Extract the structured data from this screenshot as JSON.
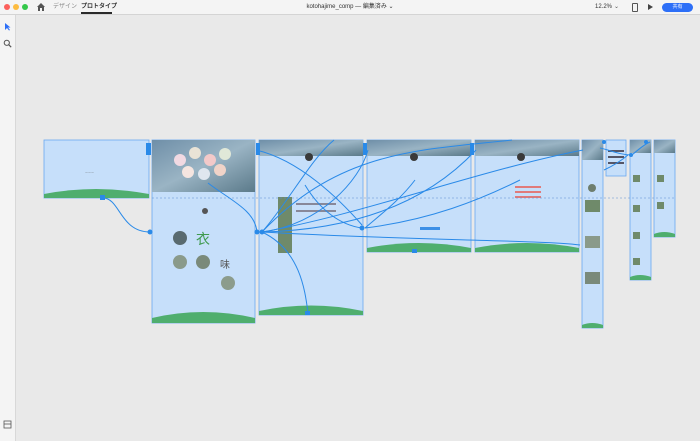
{
  "titlebar": {
    "tabs": {
      "design": "デザイン",
      "prototype": "プロトタイプ"
    },
    "document_title": "kotohajime_comp — 編集済み ⌄",
    "zoom": "12.2%",
    "share_label": "共有"
  },
  "toolbar": {
    "tools": [
      "select-arrow-icon",
      "zoom-icon",
      "document-icon"
    ]
  },
  "artboards": [
    {
      "name": "",
      "hero": false
    },
    {
      "name": "",
      "hero": true
    },
    {
      "name": "",
      "hero": true
    },
    {
      "name": "",
      "hero": true
    },
    {
      "name": "",
      "hero": true
    },
    {
      "name": "",
      "hero": true
    },
    {
      "name": "",
      "hero": false
    },
    {
      "name": "",
      "hero": true
    },
    {
      "name": "",
      "hero": true
    }
  ],
  "colors": {
    "accent": "#2d6ff7",
    "artboard_fill": "#c6dffa",
    "artboard_border": "#6aa8ef",
    "wire": "#2a8ae8",
    "footer_wave": "#4fae6e"
  }
}
